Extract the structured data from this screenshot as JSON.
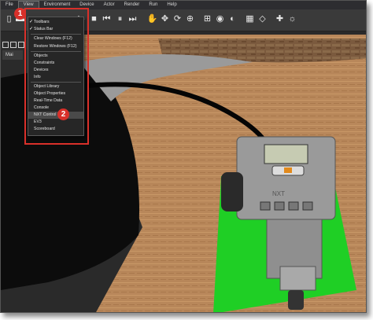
{
  "menubar": {
    "items": [
      "File",
      "View",
      "Environment",
      "Device",
      "Actor",
      "Render",
      "Run",
      "Help"
    ],
    "active_index": 1
  },
  "view_menu": {
    "items": [
      {
        "label": "Toolbars",
        "checked": true
      },
      {
        "label": "Status Bar",
        "checked": true
      },
      {
        "label": "Clear Windows (F12)",
        "checked": false
      },
      {
        "label": "Restore Windows (F12)",
        "checked": false
      },
      {
        "label": "Objects",
        "checked": false
      },
      {
        "label": "Constraints",
        "checked": false
      },
      {
        "label": "Devices",
        "checked": false
      },
      {
        "label": "Info",
        "checked": false
      },
      {
        "label": "Object Library",
        "checked": false
      },
      {
        "label": "Object Properties",
        "checked": false
      },
      {
        "label": "Real-Time Data",
        "checked": false
      },
      {
        "label": "Console",
        "checked": false
      },
      {
        "label": "NXT Control",
        "checked": false,
        "highlighted": true
      },
      {
        "label": "EV3",
        "checked": false
      },
      {
        "label": "Scoreboard",
        "checked": false
      }
    ]
  },
  "main_tab_label": "Mai",
  "callouts": {
    "one": "1",
    "two": "2"
  },
  "robot_label": "NXT",
  "colors": {
    "callout": "#d9302a",
    "floor": "#b8875a",
    "mat": "#1fcf25",
    "menu_bg": "#262626"
  },
  "toolbar_icons": [
    "new-icon",
    "open-icon",
    "play-icon",
    "stop-icon",
    "step-back-icon",
    "pause-icon",
    "step-forward-icon",
    "hand-icon",
    "move-icon",
    "rotate-icon",
    "zoom-icon",
    "fit-view-icon",
    "camera-icon",
    "shadow-icon",
    "grid-icon",
    "wireframe-icon",
    "axis-icon",
    "light-icon"
  ]
}
